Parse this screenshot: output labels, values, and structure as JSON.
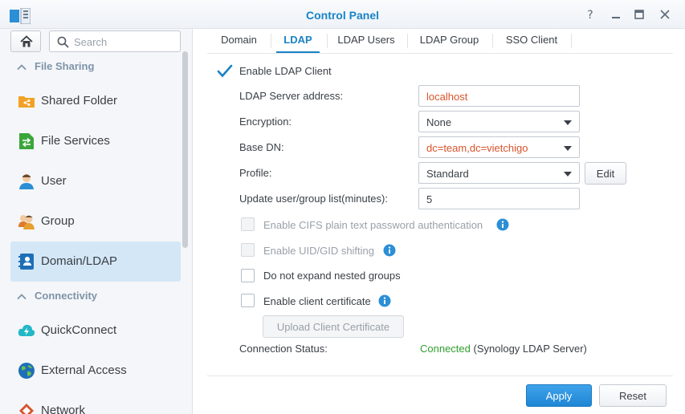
{
  "window": {
    "title": "Control Panel"
  },
  "sidebar": {
    "search_placeholder": "Search",
    "sections": [
      {
        "title": "File Sharing"
      },
      {
        "title": "Connectivity"
      }
    ],
    "items": [
      {
        "label": "Shared Folder"
      },
      {
        "label": "File Services"
      },
      {
        "label": "User"
      },
      {
        "label": "Group"
      },
      {
        "label": "Domain/LDAP"
      },
      {
        "label": "QuickConnect"
      },
      {
        "label": "External Access"
      },
      {
        "label": "Network"
      }
    ]
  },
  "tabs": [
    {
      "label": "Domain"
    },
    {
      "label": "LDAP"
    },
    {
      "label": "LDAP Users"
    },
    {
      "label": "LDAP Group"
    },
    {
      "label": "SSO Client"
    }
  ],
  "form": {
    "enable_ldap_label": "Enable LDAP Client",
    "enable_ldap_checked": true,
    "server_label": "LDAP Server address:",
    "server_value": "localhost",
    "encryption_label": "Encryption:",
    "encryption_value": "None",
    "basedn_label": "Base DN:",
    "basedn_value": "dc=team,dc=vietchigo",
    "profile_label": "Profile:",
    "profile_value": "Standard",
    "edit_label": "Edit",
    "update_label": "Update user/group list(minutes):",
    "update_value": "5",
    "cifs_label": "Enable CIFS plain text password authentication",
    "uid_label": "Enable UID/GID shifting",
    "nested_label": "Do not expand nested groups",
    "client_cert_label": "Enable client certificate",
    "upload_cert_label": "Upload Client Certificate",
    "status_label": "Connection Status:",
    "status_value": "Connected",
    "status_detail": " (Synology LDAP Server)"
  },
  "footer": {
    "apply_label": "Apply",
    "reset_label": "Reset"
  },
  "colors": {
    "accent": "#1a83c6",
    "highlight": "#d9532a",
    "success": "#2f9e2f",
    "active_bg": "#d4e7f7"
  }
}
